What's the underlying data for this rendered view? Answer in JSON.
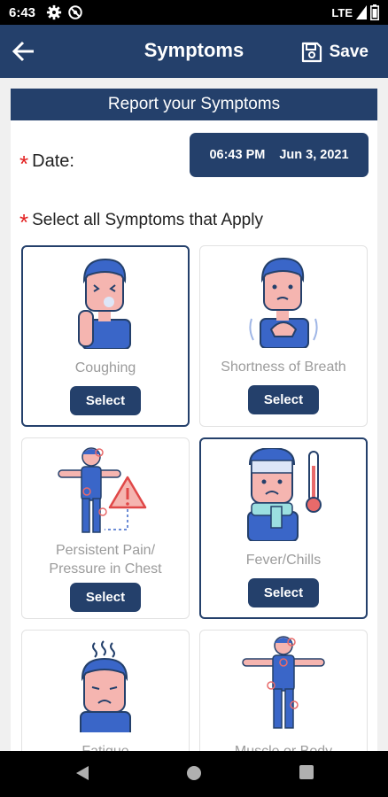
{
  "status_bar": {
    "time": "6:43",
    "network": "LTE"
  },
  "app_bar": {
    "title": "Symptoms",
    "save_label": "Save"
  },
  "panel": {
    "header": "Report your Symptoms",
    "required_mark": "*",
    "date_label": "Date:",
    "date_time": "06:43 PM",
    "date_value": "Jun 3, 2021",
    "select_all_label": "Select all Symptoms that Apply"
  },
  "symptoms": [
    {
      "label": "Coughing",
      "button": "Select",
      "selected": true,
      "icon": "coughing-person-icon"
    },
    {
      "label": "Shortness of Breath",
      "button": "Select",
      "selected": false,
      "icon": "shortness-of-breath-person-icon"
    },
    {
      "label_line1": "Persistent Pain/",
      "label_line2": "Pressure in Chest",
      "button": "Select",
      "selected": false,
      "icon": "chest-pain-warning-icon"
    },
    {
      "label": "Fever/Chills",
      "button": "Select",
      "selected": true,
      "icon": "fever-thermometer-icon"
    },
    {
      "label": "Fatigue",
      "selected": false,
      "icon": "fatigue-person-icon"
    },
    {
      "label": "Muscle or Body",
      "selected": false,
      "icon": "body-aches-person-icon"
    }
  ],
  "colors": {
    "primary": "#24406b",
    "required": "#e32020",
    "label_gray": "#9b9b9b",
    "skin": "#f5b5b0",
    "shirt": "#3a66c8"
  }
}
